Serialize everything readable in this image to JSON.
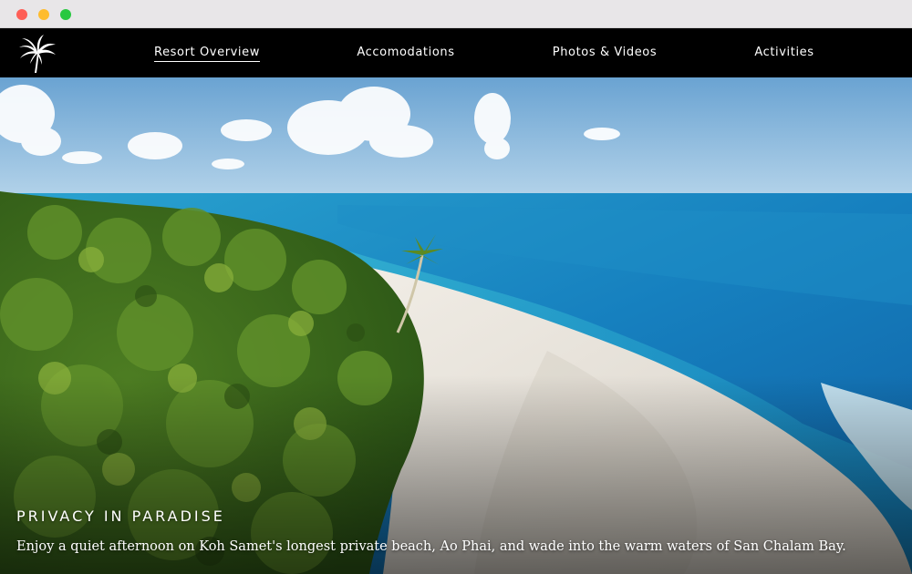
{
  "window": {
    "controls": [
      "close",
      "minimize",
      "zoom"
    ],
    "colors": {
      "close": "#fe5f57",
      "minimize": "#febc2e",
      "zoom": "#28c840"
    }
  },
  "nav": {
    "logo_icon": "palm-tree-icon",
    "items": [
      {
        "label": "Resort Overview",
        "active": true
      },
      {
        "label": "Accomodations",
        "active": false
      },
      {
        "label": "Photos & Videos",
        "active": false
      },
      {
        "label": "Activities",
        "active": false
      }
    ]
  },
  "hero": {
    "title": "PRIVACY IN PARADISE",
    "text": "Enjoy a quiet afternoon on Koh Samet's longest private beach, Ao Phai, and wade into the warm waters of San Chalam Bay."
  },
  "colors": {
    "navbar": "#000000",
    "sky": "#7fb3dc",
    "sea": "#1e86c0",
    "sand": "#e9e4dc",
    "foliage": "#3f6f1e"
  }
}
